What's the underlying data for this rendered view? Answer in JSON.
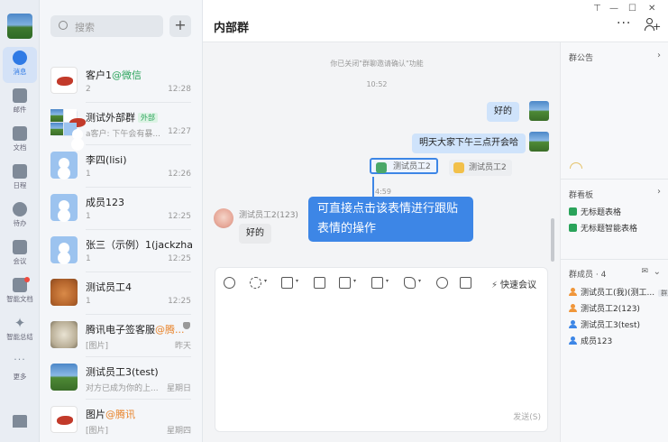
{
  "rail": {
    "items": [
      {
        "label": "消息",
        "icon": "chat-bubble-icon",
        "active": true
      },
      {
        "label": "邮件",
        "icon": "mail-icon"
      },
      {
        "label": "文档",
        "icon": "document-icon"
      },
      {
        "label": "日程",
        "icon": "calendar-icon"
      },
      {
        "label": "待办",
        "icon": "todo-check-icon"
      },
      {
        "label": "会议",
        "icon": "meeting-icon"
      },
      {
        "label": "智能文档",
        "icon": "smart-doc-icon"
      },
      {
        "label": "智能总结",
        "icon": "sparkle-icon"
      },
      {
        "label": "更多",
        "icon": "more-dots-icon"
      }
    ]
  },
  "search": {
    "placeholder": "搜索"
  },
  "conversations": [
    {
      "name": "客户1",
      "tag": "@微信",
      "tag_color": "green",
      "preview": "2",
      "time": "12:28",
      "avatar": "fish"
    },
    {
      "name": "测试外部群",
      "badge": "外部",
      "preview": "a客户: 下午会有暴...",
      "time": "12:27",
      "avatar": "group"
    },
    {
      "name": "李四(lisi)",
      "preview": "1",
      "time": "12:26",
      "avatar": "person"
    },
    {
      "name": "成员123",
      "preview": "1",
      "time": "12:25",
      "avatar": "person"
    },
    {
      "name": "张三（示例）1(jackzha...",
      "preview": "1",
      "time": "12:25",
      "avatar": "person"
    },
    {
      "name": "测试员工4",
      "preview": "1",
      "time": "12:25",
      "avatar": "face"
    },
    {
      "name": "腾讯电子签客服",
      "tag": "@腾...",
      "tag_color": "orange",
      "preview": "[图片]",
      "time": "昨天",
      "avatar": "lion",
      "muted": true
    },
    {
      "name": "测试员工3(test)",
      "preview": "对方已成为你的上...",
      "time": "星期日",
      "avatar": "landscape"
    },
    {
      "name": "图片",
      "tag": "@腾讯",
      "tag_color": "orange",
      "preview": "[图片]",
      "time": "星期四",
      "avatar": "fish"
    }
  ],
  "chat": {
    "title": "内部群",
    "system_notice": "你已关闭\"群聊邀请确认\"功能",
    "time_1": "10:52",
    "msg_ok": "好的",
    "msg_meeting": "明天大家下午三点开会哈",
    "sticker_1": "测试员工2",
    "sticker_2": "测试员工2",
    "time_2": "4:59",
    "sender": "测试员工2(123)",
    "reply": "好的",
    "tooltip": "可直接点击该表情进行跟贴表情的操作"
  },
  "composer": {
    "quick_meeting": "快速会议",
    "send": "发送(S)"
  },
  "side": {
    "notice_title": "群公告",
    "board_title": "群看板",
    "docs": [
      "无标题表格",
      "无标题智能表格"
    ],
    "members_title": "群成员 · 4",
    "members": [
      {
        "name": "测试员工(我)(测工...",
        "owner": "群主"
      },
      {
        "name": "测试员工2(123)"
      },
      {
        "name": "测试员工3(test)"
      },
      {
        "name": "成员123"
      }
    ]
  },
  "window": {
    "minimize": "—",
    "maximize": "☐",
    "close": "✕",
    "pin": "⊤",
    "more": "···"
  }
}
